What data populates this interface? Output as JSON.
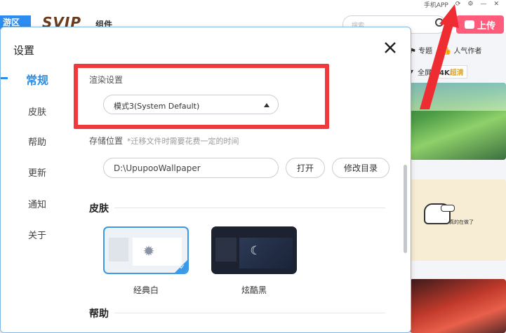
{
  "background": {
    "zone_tag": "游区",
    "svip": "SVIP",
    "theme_nav": "组件",
    "top_tools": [
      "手机APP",
      "⟳",
      "⚙",
      "—",
      "✕"
    ],
    "search_placeholder": "搜索",
    "upload_label": "上传",
    "sub_nav": [
      "⚑ 专题",
      "| 👍 人气作者"
    ],
    "filter_items": [
      "▾",
      "全屏"
    ],
    "chip_4k_a": "4K",
    "chip_4k_b": "超清",
    "thumb2_text": "真的在做了"
  },
  "dialog": {
    "title": "设置",
    "nav": [
      {
        "label": "常规"
      },
      {
        "label": "皮肤"
      },
      {
        "label": "帮助"
      },
      {
        "label": "更新"
      },
      {
        "label": "通知"
      },
      {
        "label": "关于"
      }
    ],
    "render": {
      "label": "渲染设置",
      "selected": "模式3(System Default)"
    },
    "storage": {
      "label": "存储位置",
      "hint": "*迁移文件时需要花费一定的时间",
      "path": "D:\\UpupooWallpaper",
      "open_label": "打开",
      "change_label": "修改目录"
    },
    "skin_section": "皮肤",
    "skins": [
      {
        "label": "经典白",
        "selected": true
      },
      {
        "label": "炫酷黑",
        "selected": false
      }
    ],
    "help_section": "帮助"
  },
  "colors": {
    "accent": "#2b8de3",
    "highlight": "#f0393c",
    "upload": "#ff5c7c"
  }
}
